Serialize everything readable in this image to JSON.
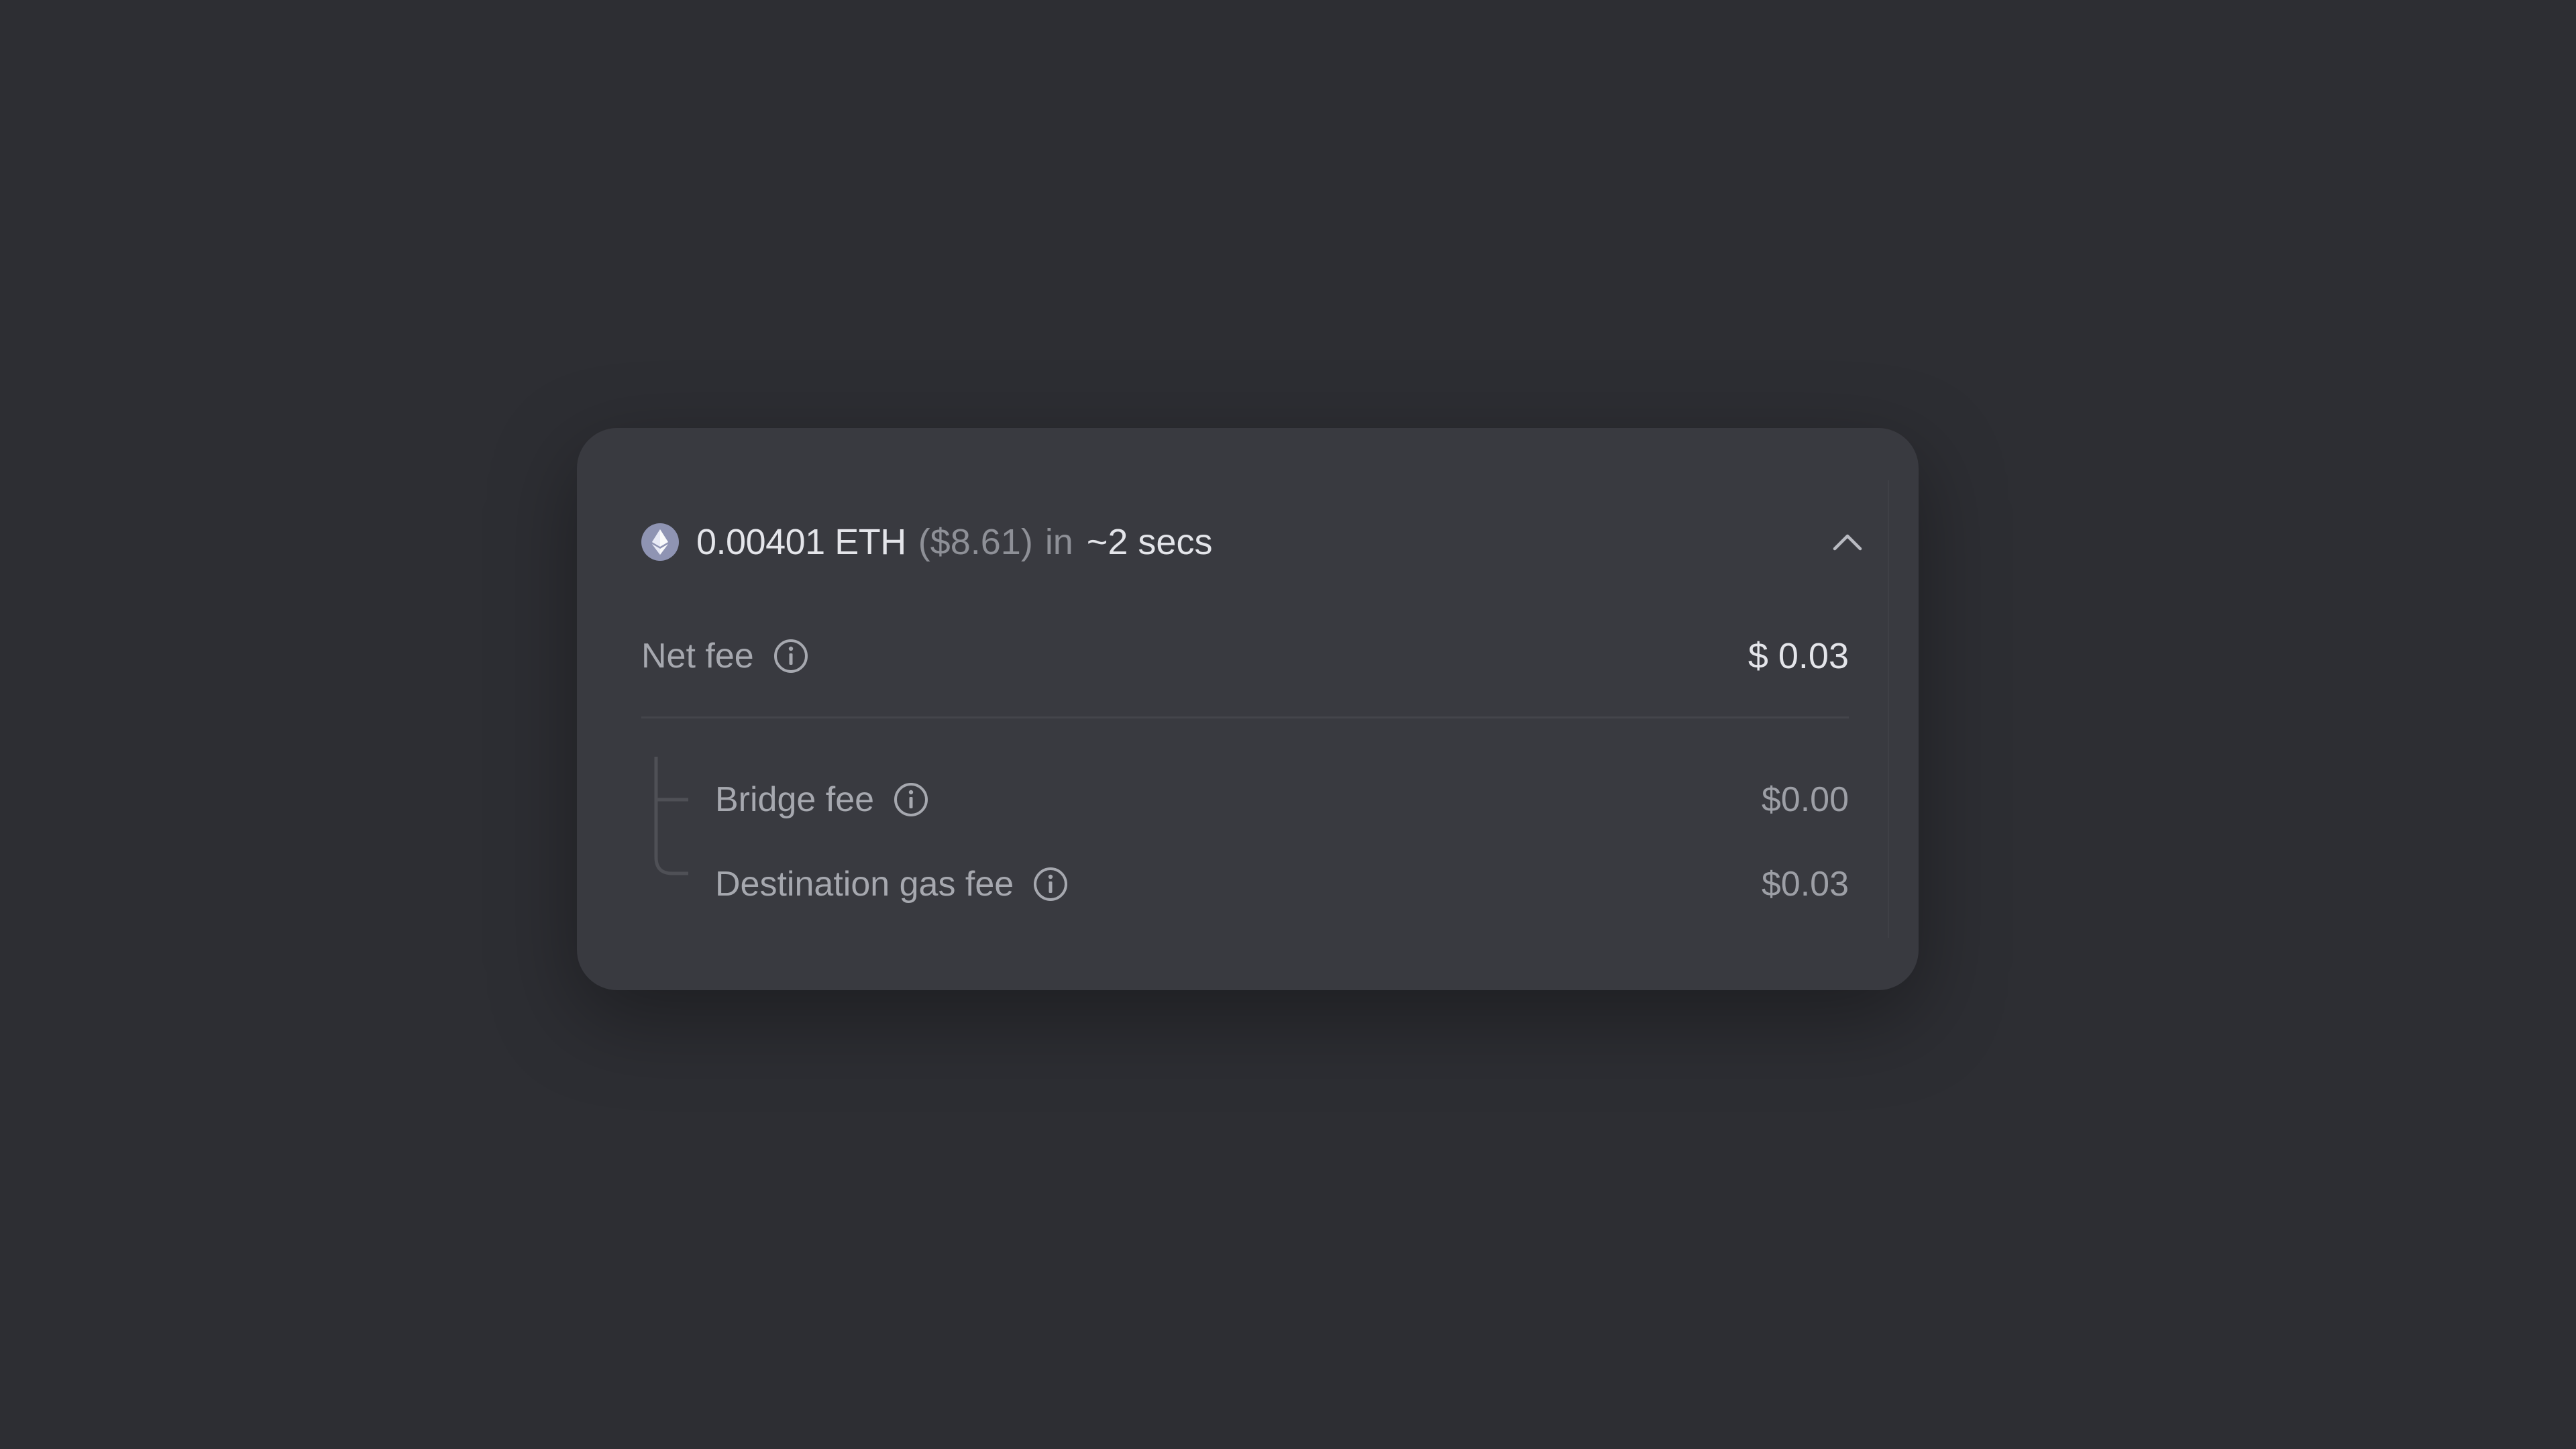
{
  "summary": {
    "amount": "0.00401 ETH",
    "usd": "($8.61)",
    "in_word": "in",
    "eta": "~2 secs",
    "token_icon": "ethereum-icon",
    "toggle_icon": "chevron-up-icon"
  },
  "fees": {
    "net": {
      "label": "Net fee",
      "value": "$ 0.03",
      "icon": "info-icon"
    },
    "breakdown": [
      {
        "label": "Bridge fee",
        "value": "$0.00",
        "icon": "info-icon"
      },
      {
        "label": "Destination gas fee",
        "value": "$0.03",
        "icon": "info-icon"
      }
    ]
  },
  "colors": {
    "background": "#2d2e33",
    "card": "#393a40",
    "text_primary": "#e4e5ea",
    "text_secondary": "#a6a8af",
    "eth_badge": "#8f94b3"
  }
}
